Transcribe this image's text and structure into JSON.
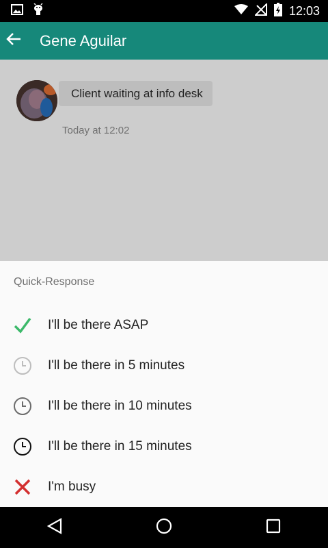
{
  "status_bar": {
    "time": "12:03",
    "icons": [
      "image-icon",
      "android-debug-icon",
      "wifi-icon",
      "no-signal-icon",
      "battery-charging-icon"
    ]
  },
  "app_bar": {
    "title": "Gene Aguilar",
    "back_icon": "arrow-back-icon",
    "color": "#16887a"
  },
  "chat": {
    "message": "Client waiting at info desk",
    "timestamp": "Today at 12:02"
  },
  "quick_response": {
    "header": "Quick-Response",
    "options": [
      {
        "label": "I'll be there ASAP",
        "icon": "check-icon",
        "color": "#3cb96a"
      },
      {
        "label": "I'll be there in 5 minutes",
        "icon": "clock-light-icon",
        "color": "#bdbdbd"
      },
      {
        "label": "I'll be there in 10 minutes",
        "icon": "clock-medium-icon",
        "color": "#6b6b6b"
      },
      {
        "label": "I'll be there in 15 minutes",
        "icon": "clock-dark-icon",
        "color": "#111111"
      },
      {
        "label": "I'm busy",
        "icon": "close-icon",
        "color": "#d32f2f"
      }
    ]
  },
  "nav_bar": {
    "icons": [
      "back-triangle-icon",
      "home-circle-icon",
      "recents-square-icon"
    ]
  }
}
